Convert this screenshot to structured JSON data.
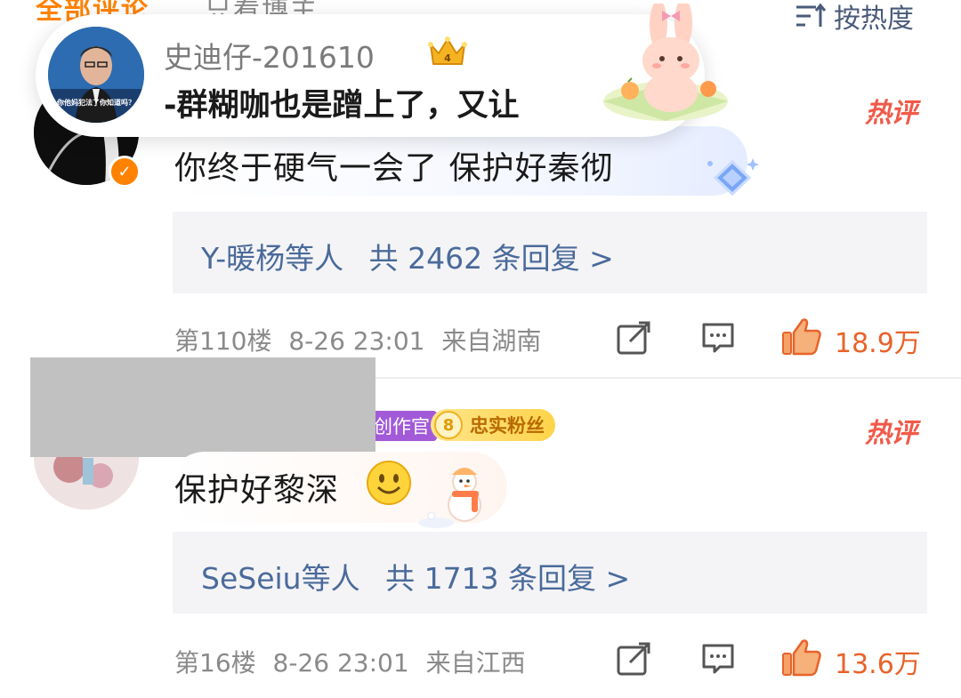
{
  "header": {
    "tab_all": "全部评论",
    "tab_host": "只看博主",
    "sort_label": "按热度"
  },
  "banner": {
    "username": "史迪仔-201610",
    "text": "-群糊咖也是蹭上了，又让",
    "avatar_caption": "你他妈犯法了你知道吗？"
  },
  "comments": [
    {
      "text": "你终于硬气一会了 保护好秦彻",
      "hot_label": "热评",
      "reply_users": "Y-暖杨等人",
      "reply_count": "共 2462 条回复 >",
      "floor": "第110楼",
      "time": "8-26 23:01",
      "location": "来自湖南",
      "likes": "18.9万"
    },
    {
      "text": "保护好黎深",
      "hot_label": "热评",
      "badge_creator": "创作官",
      "fan_level": "8",
      "fan_label": "忠实粉丝",
      "reply_users": "SeSeiu等人",
      "reply_count": "共 1713 条回复 >",
      "floor": "第16楼",
      "time": "8-26 23:01",
      "location": "来自江西",
      "likes": "13.6万"
    }
  ],
  "colors": {
    "accent": "#ff8200",
    "link": "#4a6a9a",
    "hot": "#f05a4a",
    "like": "#e8632a"
  },
  "icons": [
    "sort-icon",
    "crown-icon",
    "verified-icon",
    "gem-icon",
    "share-icon",
    "comment-icon",
    "like-icon",
    "smile-icon"
  ]
}
